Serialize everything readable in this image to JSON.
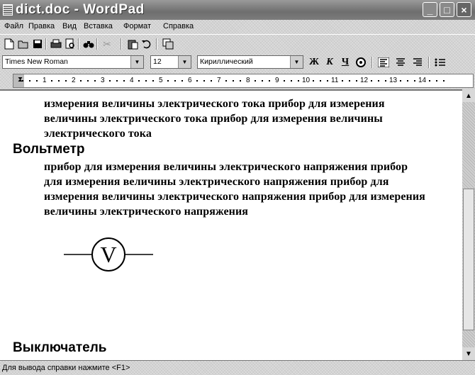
{
  "window": {
    "title": "dict.doc - WordPad"
  },
  "menu": [
    "Файл",
    "Правка",
    "Вид",
    "Вставка",
    "Формат",
    "Справка"
  ],
  "toolbar": {
    "icons": [
      "new-document-icon",
      "open-folder-icon",
      "save-icon",
      "print-icon",
      "print-preview-icon",
      "find-icon",
      "cut-icon",
      "paste-icon",
      "undo-icon",
      "insert-datetime-icon"
    ]
  },
  "format": {
    "font": "Times New Roman",
    "size": "12",
    "script": "Кириллический",
    "bold_label": "Ж",
    "italic_label": "К",
    "underline_label": "Ч"
  },
  "ruler": {
    "numbers": [
      "1",
      "2",
      "3",
      "4",
      "5",
      "6",
      "7",
      "8",
      "9",
      "10",
      "11",
      "12",
      "13",
      "14"
    ]
  },
  "document": {
    "para1_line1": "измерения величины электрического тока прибор для измерения",
    "para1_line2": "величины электрического тока прибор для измерения величины",
    "para1_line3": "электрического тока",
    "heading1": "Вольтметр",
    "para2_line1": "прибор для измерения величины электрического напряжения прибор",
    "para2_line2": "для измерения величины электрического напряжения прибор для",
    "para2_line3": "измерения величины электрического напряжения прибор для измерения",
    "para2_line4": "величины электрического напряжения",
    "symbol_letter": "V",
    "heading2": "Выключатель"
  },
  "status": {
    "text": "Для вывода справки нажмите <F1>"
  }
}
